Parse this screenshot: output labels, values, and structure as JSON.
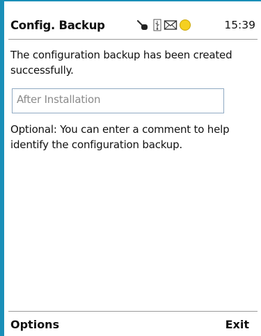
{
  "header": {
    "title": "Config. Backup",
    "time": "15:39",
    "status_icons": [
      "network-signal-icon",
      "usb-icon",
      "envelope-icon",
      "battery-icon"
    ]
  },
  "content": {
    "message": "The configuration backup has been created successfully.",
    "comment_value": "After Installation",
    "hint": "Optional: You can enter a comment to help identify the configuration backup."
  },
  "softkeys": {
    "left": "Options",
    "right": "Exit"
  },
  "colors": {
    "frame": "#1a8fb8",
    "input_border": "#8fa9c2",
    "battery": "#f5d020",
    "divider": "#9a9a9a"
  }
}
